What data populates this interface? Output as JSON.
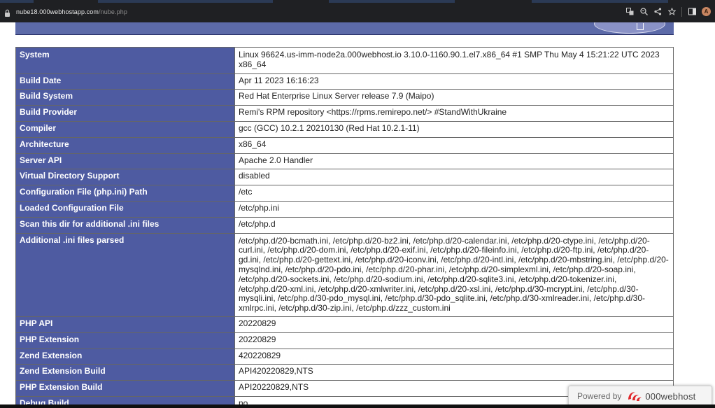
{
  "browser": {
    "url_host": "nube18.000webhostapp.com",
    "url_path": "/nube.php",
    "profile_initial": "A"
  },
  "rows": [
    {
      "key": "System",
      "value": "Linux 96624.us-imm-node2a.000webhost.io 3.10.0-1160.90.1.el7.x86_64 #1 SMP Thu May 4 15:21:22 UTC 2023 x86_64"
    },
    {
      "key": "Build Date",
      "value": "Apr 11 2023 16:16:23"
    },
    {
      "key": "Build System",
      "value": "Red Hat Enterprise Linux Server release 7.9 (Maipo)"
    },
    {
      "key": "Build Provider",
      "value": "Remi's RPM repository <https://rpms.remirepo.net/> #StandWithUkraine"
    },
    {
      "key": "Compiler",
      "value": "gcc (GCC) 10.2.1 20210130 (Red Hat 10.2.1-11)"
    },
    {
      "key": "Architecture",
      "value": "x86_64"
    },
    {
      "key": "Server API",
      "value": "Apache 2.0 Handler"
    },
    {
      "key": "Virtual Directory Support",
      "value": "disabled"
    },
    {
      "key": "Configuration File (php.ini) Path",
      "value": "/etc"
    },
    {
      "key": "Loaded Configuration File",
      "value": "/etc/php.ini"
    },
    {
      "key": "Scan this dir for additional .ini files",
      "value": "/etc/php.d"
    },
    {
      "key": "Additional .ini files parsed",
      "value": "/etc/php.d/20-bcmath.ini, /etc/php.d/20-bz2.ini, /etc/php.d/20-calendar.ini, /etc/php.d/20-ctype.ini, /etc/php.d/20-curl.ini, /etc/php.d/20-dom.ini, /etc/php.d/20-exif.ini, /etc/php.d/20-fileinfo.ini, /etc/php.d/20-ftp.ini, /etc/php.d/20-gd.ini, /etc/php.d/20-gettext.ini, /etc/php.d/20-iconv.ini, /etc/php.d/20-intl.ini, /etc/php.d/20-mbstring.ini, /etc/php.d/20-mysqlnd.ini, /etc/php.d/20-pdo.ini, /etc/php.d/20-phar.ini, /etc/php.d/20-simplexml.ini, /etc/php.d/20-soap.ini, /etc/php.d/20-sockets.ini, /etc/php.d/20-sodium.ini, /etc/php.d/20-sqlite3.ini, /etc/php.d/20-tokenizer.ini, /etc/php.d/20-xml.ini, /etc/php.d/20-xmlwriter.ini, /etc/php.d/20-xsl.ini, /etc/php.d/30-mcrypt.ini, /etc/php.d/30-mysqli.ini, /etc/php.d/30-pdo_mysql.ini, /etc/php.d/30-pdo_sqlite.ini, /etc/php.d/30-xmlreader.ini, /etc/php.d/30-xmlrpc.ini, /etc/php.d/30-zip.ini, /etc/php.d/zzz_custom.ini"
    },
    {
      "key": "PHP API",
      "value": "20220829"
    },
    {
      "key": "PHP Extension",
      "value": "20220829"
    },
    {
      "key": "Zend Extension",
      "value": "420220829"
    },
    {
      "key": "Zend Extension Build",
      "value": "API420220829,NTS"
    },
    {
      "key": "PHP Extension Build",
      "value": "API20220829,NTS"
    },
    {
      "key": "Debug Build",
      "value": "no"
    }
  ],
  "powered": {
    "label": "Powered by",
    "brand": "000webhost"
  },
  "colors": {
    "header_cell": "#4e5ba1",
    "banner": "#5c6aa8",
    "brand_red": "#e0262b"
  }
}
